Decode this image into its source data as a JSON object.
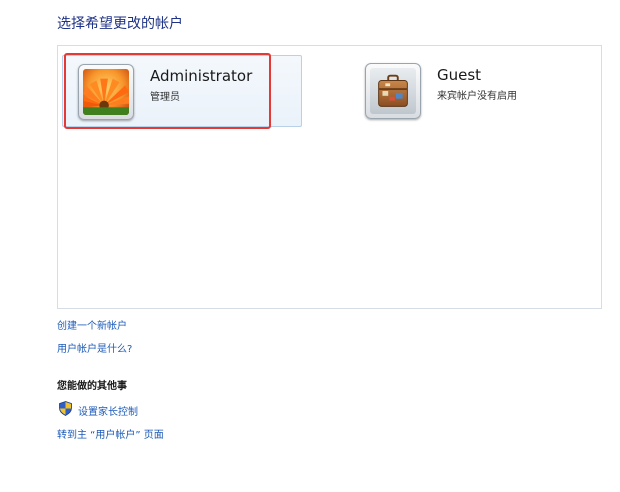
{
  "heading": "选择希望更改的帐户",
  "accounts": [
    {
      "name": "Administrator",
      "role": "管理员",
      "icon": "flower-avatar-icon",
      "selected": true
    },
    {
      "name": "Guest",
      "role": "来宾帐户没有启用",
      "icon": "suitcase-avatar-icon",
      "selected": false
    }
  ],
  "links": {
    "create_account": "创建一个新帐户",
    "what_is_account": "用户帐户是什么?"
  },
  "other_tasks": {
    "title": "您能做的其他事",
    "parental_controls": "设置家长控制",
    "goto_user_accounts": "转到主 “用户帐户” 页面"
  },
  "colors": {
    "heading": "#1e3287",
    "link": "#1c5bb8",
    "selection_outline": "#e53935"
  }
}
